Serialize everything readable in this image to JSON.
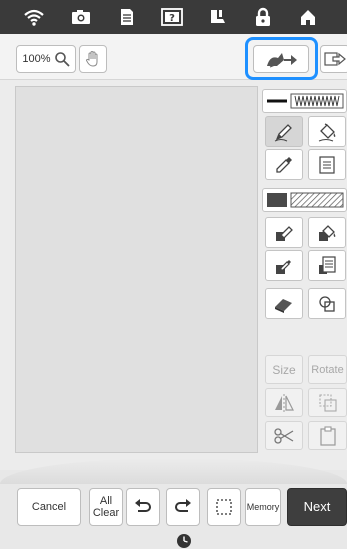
{
  "toolbar": {
    "zoom_label": "100%",
    "import_icon": "import-image-icon",
    "export_icon": "export-icon"
  },
  "status_icons": [
    "wifi-icon",
    "camera-icon",
    "document-icon",
    "help-icon",
    "sewing-foot-icon",
    "lock-icon",
    "home-icon"
  ],
  "right_panel": {
    "line_type_icon": "zigzag-stitch-icon",
    "size_label": "Size",
    "rotate_label": "Rotate"
  },
  "bottom": {
    "cancel_label": "Cancel",
    "all_clear_line1": "All",
    "all_clear_line2": "Clear",
    "memory_label": "Memory",
    "next_label": "Next"
  },
  "colors": {
    "highlight": "#1e90ff",
    "topbar": "#3a3a3a",
    "next_button": "#3e3e3e"
  }
}
